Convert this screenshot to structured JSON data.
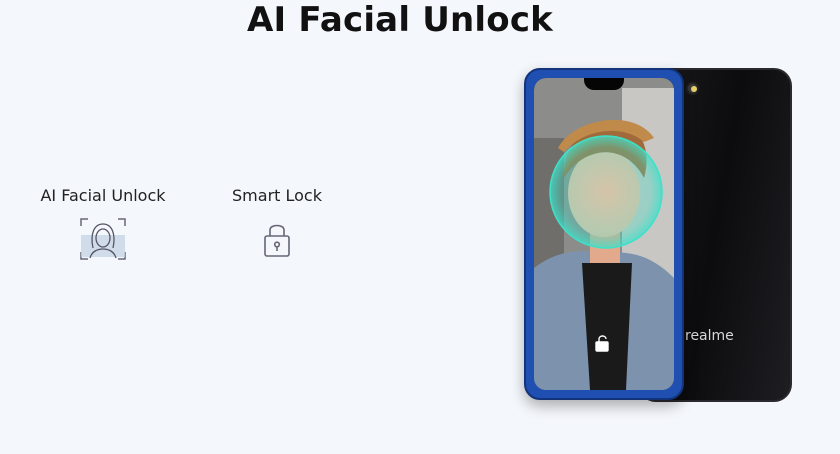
{
  "page": {
    "title": "AI Facial Unlock"
  },
  "features": [
    {
      "label": "AI Facial Unlock",
      "icon": "face-scan-icon"
    },
    {
      "label": "Smart Lock",
      "icon": "padlock-icon"
    }
  ],
  "phone": {
    "brand": "realme"
  },
  "colors": {
    "accent_blue": "#1f4fb0",
    "scan_teal": "#3fe0c8",
    "background": "#f4f7fb"
  }
}
